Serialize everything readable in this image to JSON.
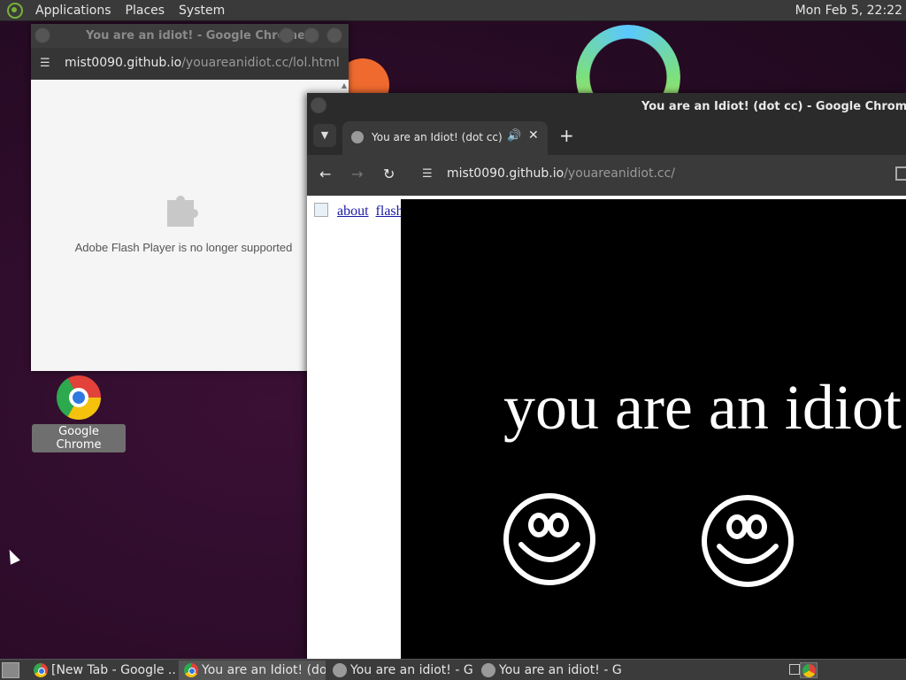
{
  "top_panel": {
    "menus": [
      "Applications",
      "Places",
      "System"
    ],
    "clock": "Mon Feb  5, 22:22"
  },
  "desktop": {
    "icon_label": "Google Chrome"
  },
  "back_window": {
    "title": "You are an idiot! - Google Chrome",
    "url_host": "mist0090.github.io",
    "url_path": "/youareanidiot.cc/lol.html",
    "plugin_message": "Adobe Flash Player is no longer supported"
  },
  "front_window": {
    "title": "You are an Idiot! (dot cc) - Google Chrome",
    "tab_title": "You are an Idiot! (dot cc)",
    "url_host": "mist0090.github.io",
    "url_path": "/youareanidiot.cc/",
    "links": [
      "about",
      "flash"
    ],
    "headline": "you are an idiot"
  },
  "taskbar": {
    "tasks": [
      {
        "label": "[New Tab - Google ...",
        "icon": "chrome-icon",
        "active": false
      },
      {
        "label": "You are an Idiot! (do...",
        "icon": "chrome-icon",
        "active": true
      },
      {
        "label": "You are an idiot! - G...",
        "icon": "globe-icon",
        "active": false
      },
      {
        "label": "You are an idiot! - G...",
        "icon": "globe-icon",
        "active": false
      }
    ]
  },
  "colors": {
    "desktop_bg": "#2a0b27",
    "panel_bg": "#3a3a3a",
    "link": "#1a1aa6",
    "idiot_bg": "#000000",
    "idiot_fg": "#ffffff"
  }
}
